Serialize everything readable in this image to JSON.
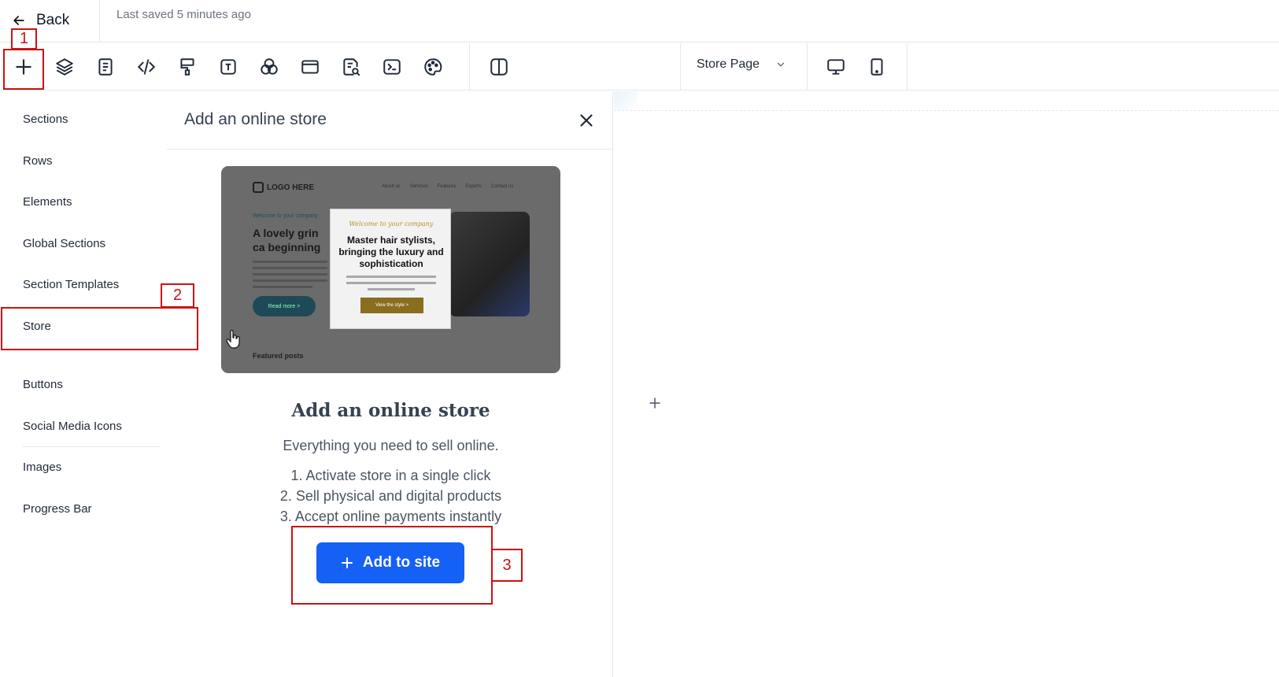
{
  "header": {
    "back_label": "Back",
    "saved_text": "Last saved 5 minutes ago"
  },
  "toolbar": {
    "icons": [
      "plus-icon",
      "layers-icon",
      "page-icon",
      "code-icon",
      "paint-roller-icon",
      "text-icon",
      "color-circles-icon",
      "browser-window-icon",
      "search-doc-icon",
      "terminal-icon",
      "palette-icon",
      "split-view-icon",
      "desktop-icon",
      "mobile-icon"
    ],
    "page_select": "Store Page"
  },
  "sidebar": {
    "items": [
      "Sections",
      "Rows",
      "Elements",
      "Global Sections",
      "Section Templates",
      "Store",
      "Buttons",
      "Social Media Icons",
      "Images",
      "Progress Bar"
    ],
    "selected": "Store"
  },
  "panel": {
    "title": "Add an online store",
    "preview": {
      "logo": "LOGO HERE",
      "nav": [
        "About us",
        "Services",
        "Features",
        "Experts",
        "Contact us"
      ],
      "welcome": "Welcome to your company",
      "headline": "A lovely grin ca beginning",
      "read_more": "Read more >",
      "card_script": "Welcome to your company",
      "card_title": "Master hair stylists, bringing the luxury and sophistication",
      "card_button": "View the style >",
      "featured": "Featured posts"
    },
    "heading": "Add an online store",
    "subtitle": "Everything you need to sell online.",
    "list": [
      "1. Activate store in a single click",
      "2. Sell physical and digital products",
      "3. Accept online payments instantly"
    ],
    "add_button": "Add to site"
  },
  "annotations": [
    "1",
    "2",
    "3"
  ],
  "colors": {
    "primary_button": "#1560f5",
    "annotation_red": "#cc1111"
  }
}
